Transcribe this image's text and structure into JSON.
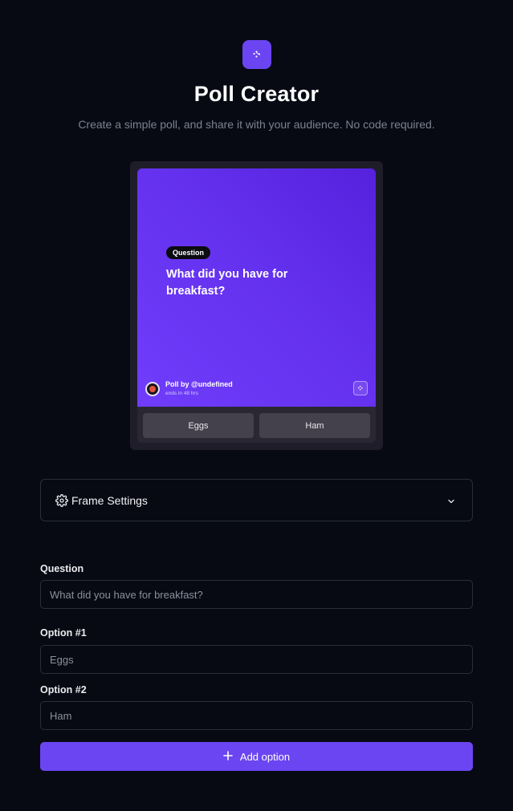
{
  "header": {
    "logo_icon": "poll-logo-icon",
    "title": "Poll Creator",
    "subtitle": "Create a simple poll, and share it with your audience. No code required."
  },
  "preview": {
    "badge": "Question",
    "question": "What did you have for breakfast?",
    "author": "Poll by @undefined",
    "ends": "ends in 48 hrs",
    "options": [
      "Eggs",
      "Ham"
    ],
    "gradient_colors": [
      "#5521dd",
      "#6f3dfb"
    ]
  },
  "settings": {
    "icon": "gear-icon",
    "label": "Frame Settings",
    "toggle_icon": "chevron-down-icon"
  },
  "form": {
    "question_label": "Question",
    "question_placeholder": "What did you have for breakfast?",
    "option1_label": "Option #1",
    "option1_placeholder": "Eggs",
    "option2_label": "Option #2",
    "option2_placeholder": "Ham"
  },
  "add_button": {
    "icon": "plus-icon",
    "label": "Add option"
  },
  "colors": {
    "background": "#070a13",
    "accent": "#6b45f2",
    "border": "#2a2e3a",
    "muted_text": "#7c8190"
  }
}
